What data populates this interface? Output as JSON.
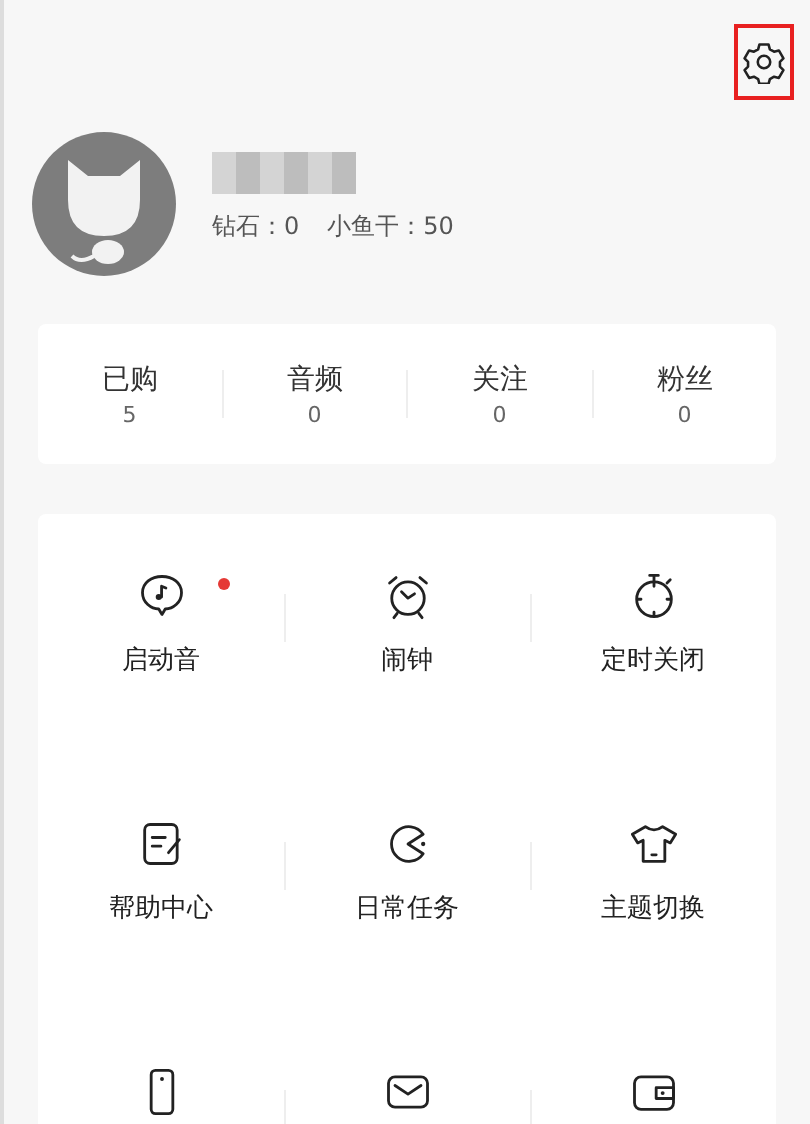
{
  "profile": {
    "diamonds_label": "钻石：0",
    "fish_label": "小鱼干：50"
  },
  "stats": [
    {
      "label": "已购",
      "value": "5"
    },
    {
      "label": "音频",
      "value": "0"
    },
    {
      "label": "关注",
      "value": "0"
    },
    {
      "label": "粉丝",
      "value": "0"
    }
  ],
  "features": [
    {
      "label": "启动音",
      "dot": true
    },
    {
      "label": "闹钟",
      "dot": false
    },
    {
      "label": "定时关闭",
      "dot": false
    },
    {
      "label": "帮助中心",
      "dot": false
    },
    {
      "label": "日常任务",
      "dot": false
    },
    {
      "label": "主题切换",
      "dot": false
    },
    {
      "dot": false
    },
    {
      "dot": false
    },
    {
      "dot": false
    }
  ]
}
